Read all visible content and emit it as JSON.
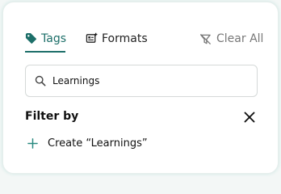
{
  "tabs": [
    {
      "label": "Tags",
      "active": true,
      "icon": "tag-icon"
    },
    {
      "label": "Formats",
      "active": false,
      "icon": "format-list-icon"
    }
  ],
  "clear_all": {
    "label": "Clear All",
    "icon": "filter-off-icon"
  },
  "search": {
    "value": "Learnings",
    "icon": "search-icon"
  },
  "filter": {
    "title": "Filter by",
    "close_icon": "close-icon",
    "create_label": "Create “Learnings”",
    "create_icon": "plus-icon"
  },
  "colors": {
    "accent": "#1d6f69",
    "create_plus": "#2a8a80",
    "muted": "#777777",
    "border": "#d5d9d8"
  }
}
